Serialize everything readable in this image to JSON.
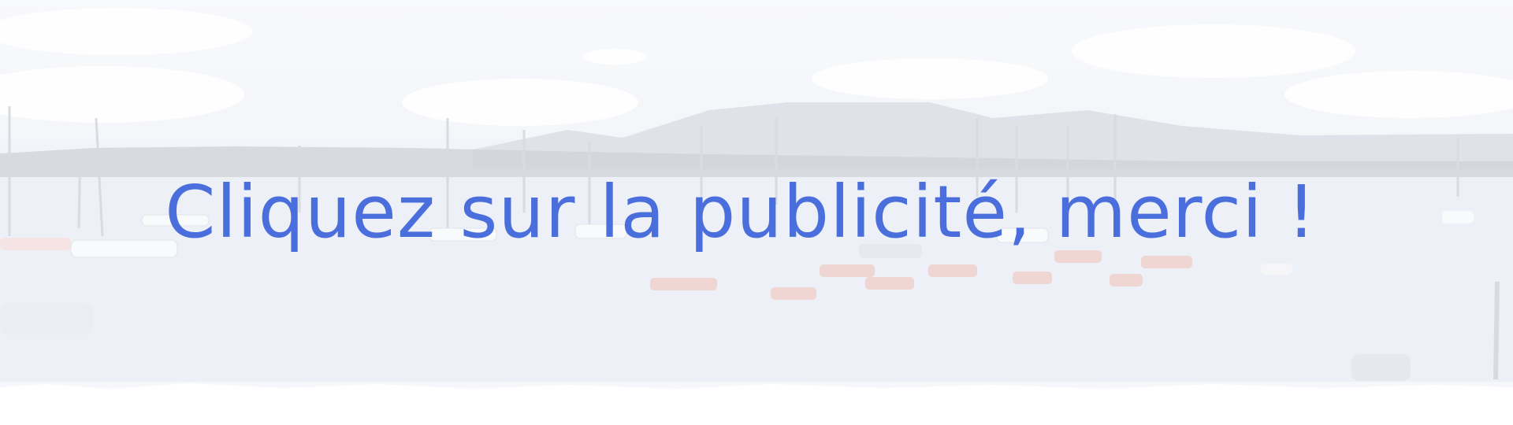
{
  "banner": {
    "headline": "Cliquez sur la publicité, merci !",
    "headline_color": "#4a6fdc",
    "background": "faded photo of sailboats and small boats moored on a lake with mountains behind"
  }
}
